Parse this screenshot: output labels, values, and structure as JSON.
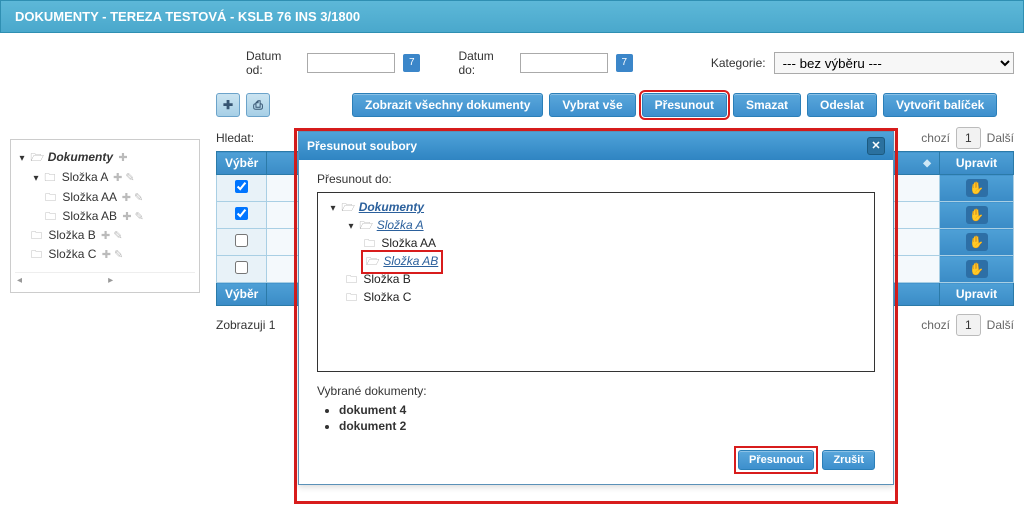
{
  "title": "DOKUMENTY - TEREZA TESTOVÁ - KSLB 76 INS 3/1800",
  "filters": {
    "date_from_label": "Datum od:",
    "date_to_label": "Datum do:",
    "kategorie_label": "Kategorie:",
    "kategorie_placeholder": "--- bez výběru ---"
  },
  "toolbar": {
    "zobrazit": "Zobrazit všechny dokumenty",
    "vybrat_vse": "Vybrat vše",
    "presunout": "Přesunout",
    "smazat": "Smazat",
    "odeslat": "Odeslat",
    "vytvorit_balicek": "Vytvořit balíček"
  },
  "search": {
    "label": "Hledat:"
  },
  "pager": {
    "prev": "Předchozí",
    "prev_short": "chozí",
    "page": "1",
    "next": "Další"
  },
  "table": {
    "col_vyber": "Výběr",
    "col_upravit": "Upravit",
    "rows": [
      {
        "checked": true
      },
      {
        "checked": true
      },
      {
        "checked": false
      },
      {
        "checked": false
      }
    ]
  },
  "sidebar": {
    "root": "Dokumenty",
    "items": {
      "a": "Složka A",
      "aa": "Složka AA",
      "ab": "Složka AB",
      "b": "Složka B",
      "c": "Složka C"
    }
  },
  "footer": {
    "status_prefix": "Zobrazuji 1"
  },
  "modal": {
    "title": "Přesunout soubory",
    "dest_label": "Přesunout do:",
    "tree": {
      "root": "Dokumenty",
      "a": "Složka A",
      "aa": "Složka AA",
      "ab": "Složka AB",
      "b": "Složka B",
      "c": "Složka C"
    },
    "selected_label": "Vybrané dokumenty:",
    "selected_docs": [
      "dokument 4",
      "dokument 2"
    ],
    "ok": "Přesunout",
    "cancel": "Zrušit"
  }
}
